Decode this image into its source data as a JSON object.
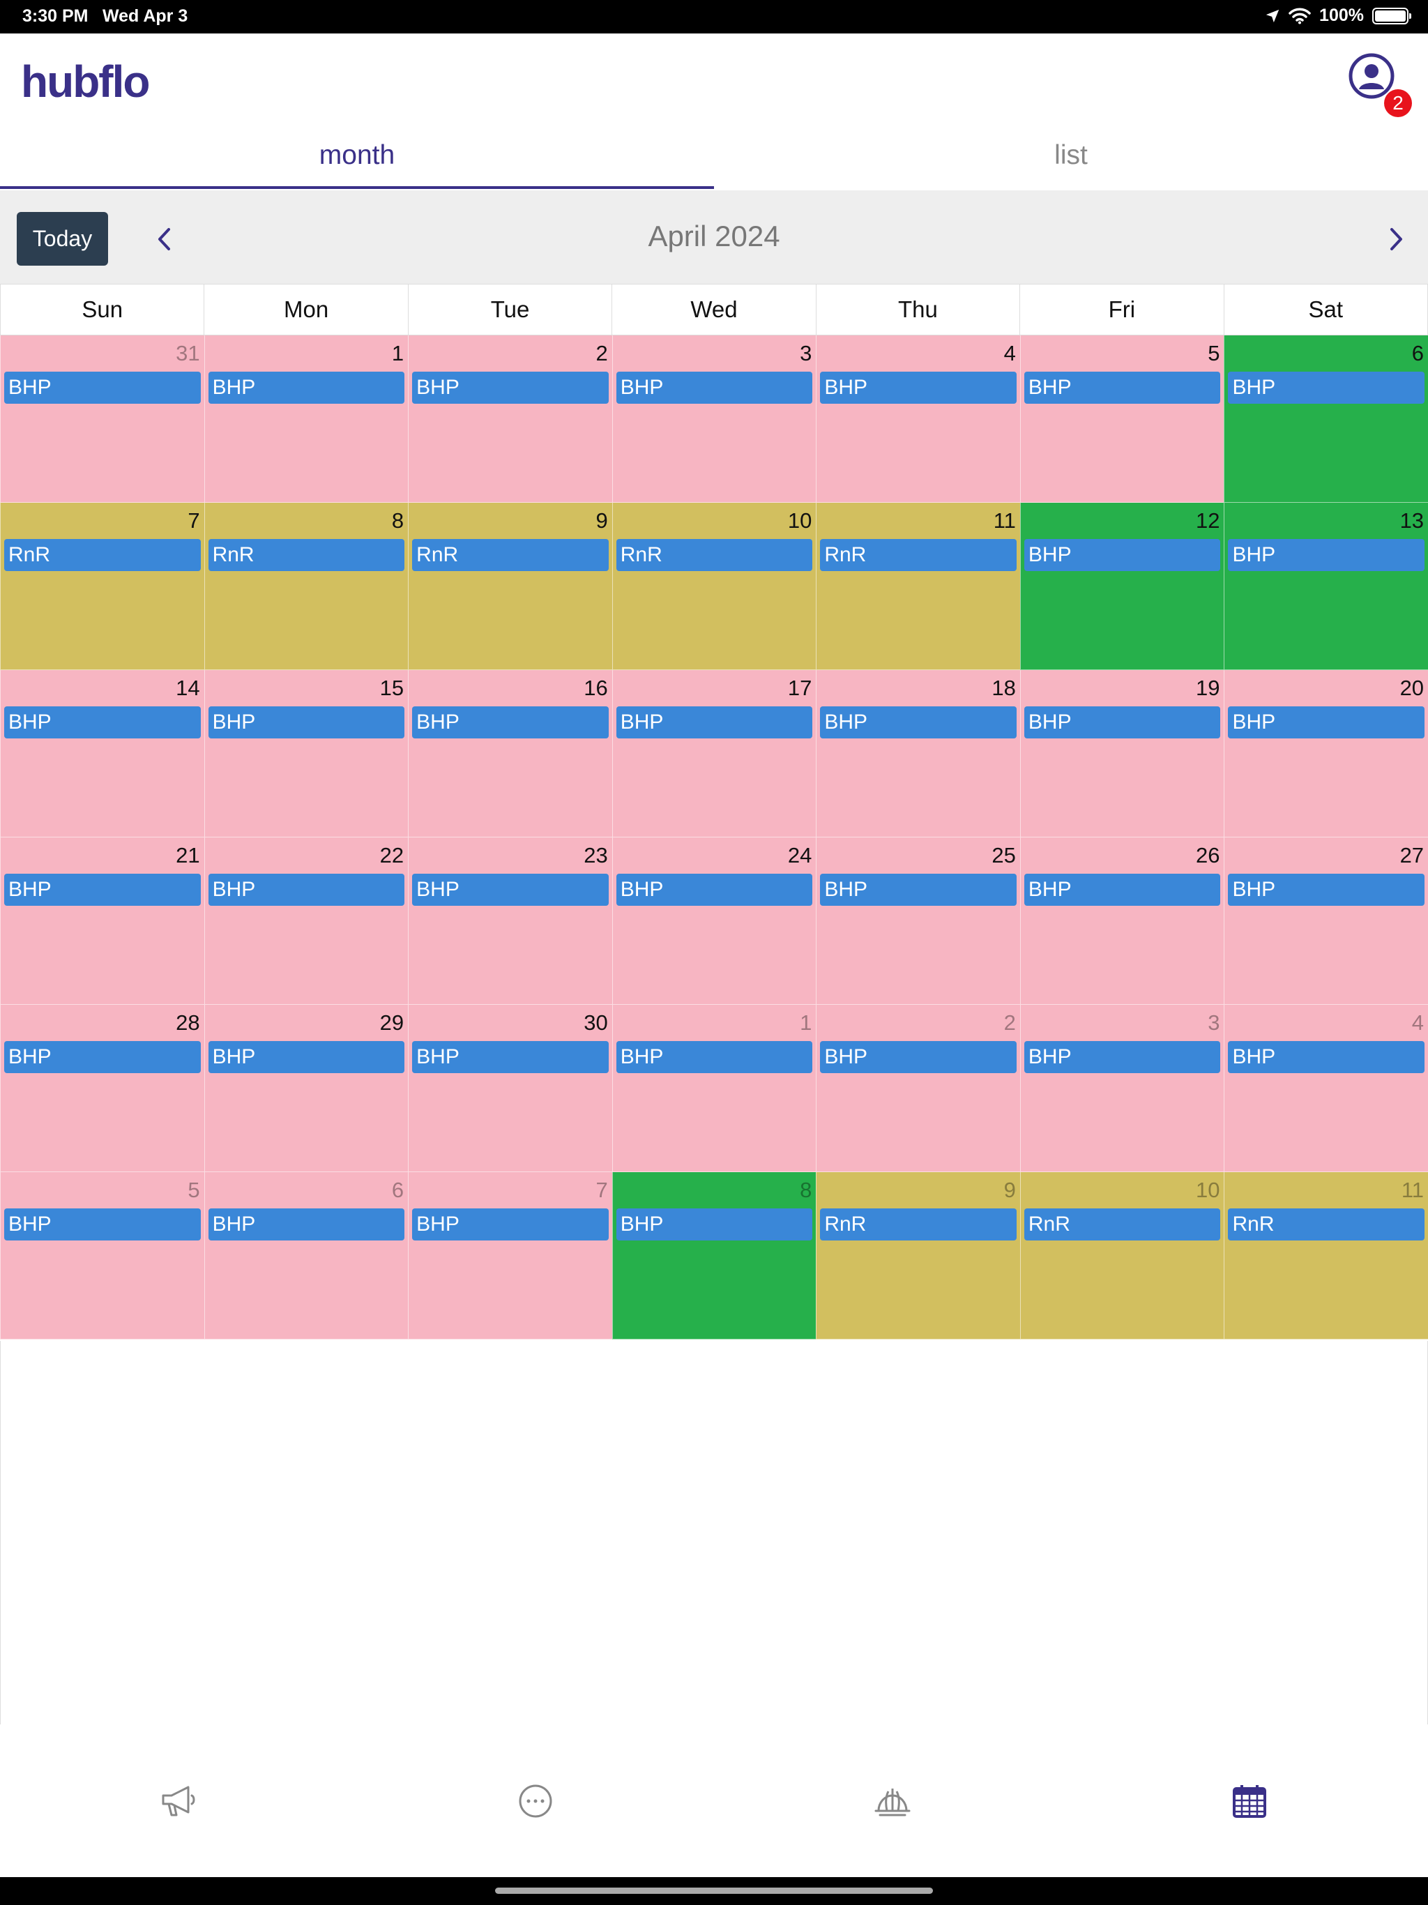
{
  "status_bar": {
    "time": "3:30 PM",
    "date": "Wed Apr 3",
    "battery": "100%"
  },
  "header": {
    "logo": "hubflo",
    "notification_count": "2"
  },
  "tabs": [
    {
      "label": "month",
      "active": true
    },
    {
      "label": "list",
      "active": false
    }
  ],
  "toolbar": {
    "today_label": "Today",
    "month_title": "April 2024"
  },
  "weekdays": [
    "Sun",
    "Mon",
    "Tue",
    "Wed",
    "Thu",
    "Fri",
    "Sat"
  ],
  "colors": {
    "pink": "#f7b5c2",
    "gold": "#d2bf5f",
    "green": "#26b04b",
    "event": "#3a87d8",
    "brand": "#3a3088"
  },
  "weeks": [
    [
      {
        "day": "31",
        "other": true,
        "color": "pink",
        "event": "BHP"
      },
      {
        "day": "1",
        "other": false,
        "color": "pink",
        "event": "BHP"
      },
      {
        "day": "2",
        "other": false,
        "color": "pink",
        "event": "BHP"
      },
      {
        "day": "3",
        "other": false,
        "color": "pink",
        "event": "BHP"
      },
      {
        "day": "4",
        "other": false,
        "color": "pink",
        "event": "BHP"
      },
      {
        "day": "5",
        "other": false,
        "color": "pink",
        "event": "BHP"
      },
      {
        "day": "6",
        "other": false,
        "color": "green",
        "event": "BHP"
      }
    ],
    [
      {
        "day": "7",
        "other": false,
        "color": "gold",
        "event": "RnR"
      },
      {
        "day": "8",
        "other": false,
        "color": "gold",
        "event": "RnR"
      },
      {
        "day": "9",
        "other": false,
        "color": "gold",
        "event": "RnR"
      },
      {
        "day": "10",
        "other": false,
        "color": "gold",
        "event": "RnR"
      },
      {
        "day": "11",
        "other": false,
        "color": "gold",
        "event": "RnR"
      },
      {
        "day": "12",
        "other": false,
        "color": "green",
        "event": "BHP"
      },
      {
        "day": "13",
        "other": false,
        "color": "green",
        "event": "BHP"
      }
    ],
    [
      {
        "day": "14",
        "other": false,
        "color": "pink",
        "event": "BHP"
      },
      {
        "day": "15",
        "other": false,
        "color": "pink",
        "event": "BHP"
      },
      {
        "day": "16",
        "other": false,
        "color": "pink",
        "event": "BHP"
      },
      {
        "day": "17",
        "other": false,
        "color": "pink",
        "event": "BHP"
      },
      {
        "day": "18",
        "other": false,
        "color": "pink",
        "event": "BHP"
      },
      {
        "day": "19",
        "other": false,
        "color": "pink",
        "event": "BHP"
      },
      {
        "day": "20",
        "other": false,
        "color": "pink",
        "event": "BHP"
      }
    ],
    [
      {
        "day": "21",
        "other": false,
        "color": "pink",
        "event": "BHP"
      },
      {
        "day": "22",
        "other": false,
        "color": "pink",
        "event": "BHP"
      },
      {
        "day": "23",
        "other": false,
        "color": "pink",
        "event": "BHP"
      },
      {
        "day": "24",
        "other": false,
        "color": "pink",
        "event": "BHP"
      },
      {
        "day": "25",
        "other": false,
        "color": "pink",
        "event": "BHP"
      },
      {
        "day": "26",
        "other": false,
        "color": "pink",
        "event": "BHP"
      },
      {
        "day": "27",
        "other": false,
        "color": "pink",
        "event": "BHP"
      }
    ],
    [
      {
        "day": "28",
        "other": false,
        "color": "pink",
        "event": "BHP"
      },
      {
        "day": "29",
        "other": false,
        "color": "pink",
        "event": "BHP"
      },
      {
        "day": "30",
        "other": false,
        "color": "pink",
        "event": "BHP"
      },
      {
        "day": "1",
        "other": true,
        "color": "pink",
        "event": "BHP"
      },
      {
        "day": "2",
        "other": true,
        "color": "pink",
        "event": "BHP"
      },
      {
        "day": "3",
        "other": true,
        "color": "pink",
        "event": "BHP"
      },
      {
        "day": "4",
        "other": true,
        "color": "pink",
        "event": "BHP"
      }
    ],
    [
      {
        "day": "5",
        "other": true,
        "color": "pink",
        "event": "BHP"
      },
      {
        "day": "6",
        "other": true,
        "color": "pink",
        "event": "BHP"
      },
      {
        "day": "7",
        "other": true,
        "color": "pink",
        "event": "BHP"
      },
      {
        "day": "8",
        "other": true,
        "color": "green",
        "event": "BHP"
      },
      {
        "day": "9",
        "other": true,
        "color": "gold",
        "event": "RnR"
      },
      {
        "day": "10",
        "other": true,
        "color": "gold",
        "event": "RnR"
      },
      {
        "day": "11",
        "other": true,
        "color": "gold",
        "event": "RnR"
      }
    ]
  ],
  "bottom_nav": [
    {
      "icon": "megaphone-icon",
      "active": false
    },
    {
      "icon": "more-dots-icon",
      "active": false
    },
    {
      "icon": "hard-hat-icon",
      "active": false
    },
    {
      "icon": "calendar-icon",
      "active": true
    }
  ]
}
